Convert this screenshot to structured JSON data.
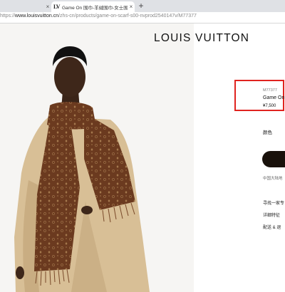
{
  "browser": {
    "tabs": [
      {
        "label": "",
        "active": false
      },
      {
        "label": "Game On 围巾-羊绒围巾-女士围",
        "active": true
      }
    ],
    "favicon_glyph": "LV",
    "close_glyph": "×",
    "new_tab_glyph": "+",
    "url_prefix": "https://",
    "url_host": "www.louisvuitton.cn",
    "url_path": "/zhs-cn/products/game-on-scarf-s00-nvprod2540147v/M77377"
  },
  "product": {
    "brand": "LOUIS VUITTON",
    "code": "M77377",
    "name": "Game On",
    "price": "¥7,500",
    "color_label": "颜色",
    "service_note": "中国大陆地",
    "links": [
      "寻找一家专",
      "详细特征",
      "配送 & 退"
    ]
  },
  "colors": {
    "accent_highlight": "#e0231f",
    "button": "#19110b",
    "scarf": "#6b3a1f",
    "coat": "#d8bf96"
  }
}
